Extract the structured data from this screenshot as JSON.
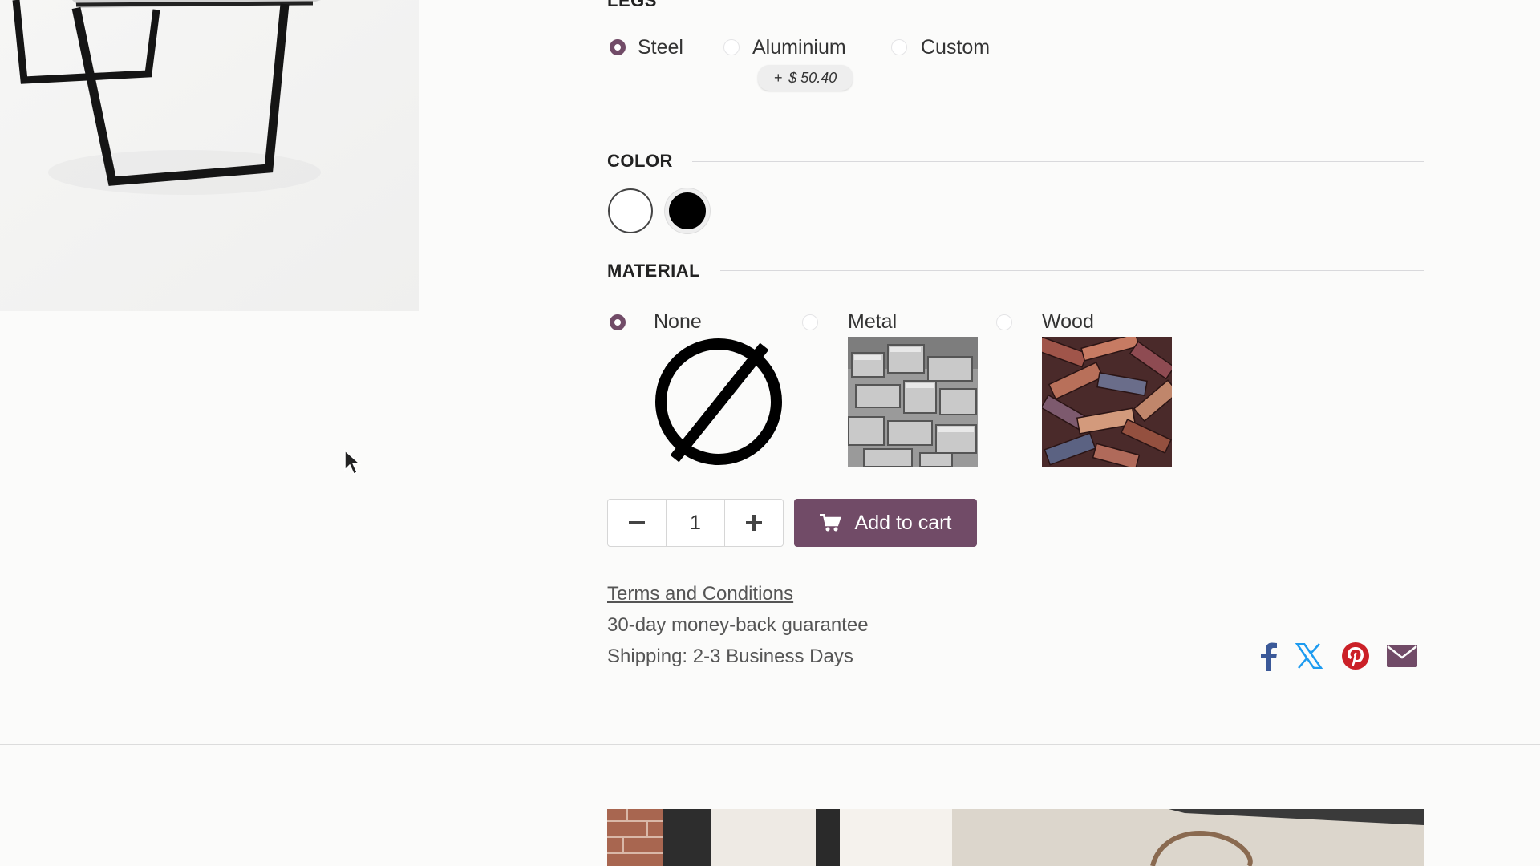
{
  "legs": {
    "title": "LEGS",
    "options": [
      {
        "label": "Steel",
        "selected": true
      },
      {
        "label": "Aluminium",
        "selected": false,
        "price_extra": "$ 50.40",
        "price_sign": "+"
      },
      {
        "label": "Custom",
        "selected": false
      }
    ]
  },
  "color": {
    "title": "COLOR",
    "swatches": [
      {
        "name": "White",
        "hex": "#ffffff",
        "selected": true
      },
      {
        "name": "Black",
        "hex": "#000000",
        "selected": false
      }
    ]
  },
  "material": {
    "title": "MATERIAL",
    "options": [
      {
        "label": "None",
        "selected": true,
        "image": "none-icon"
      },
      {
        "label": "Metal",
        "selected": false,
        "image": "metal-bars-image"
      },
      {
        "label": "Wood",
        "selected": false,
        "image": "wood-pieces-image"
      }
    ]
  },
  "quantity": {
    "value": "1",
    "minus_icon": "minus-icon",
    "plus_icon": "plus-icon"
  },
  "cart": {
    "button_label": "Add to cart",
    "icon": "cart-icon"
  },
  "info": {
    "terms": "Terms and Conditions",
    "guarantee": "30-day money-back guarantee",
    "shipping": "Shipping: 2-3 Business Days"
  },
  "share": [
    "facebook-icon",
    "x-icon",
    "pinterest-icon",
    "email-icon"
  ],
  "colors": {
    "accent": "#714b67",
    "facebook": "#3b5998",
    "x": "#1d9bf0",
    "pinterest": "#cb2027"
  }
}
